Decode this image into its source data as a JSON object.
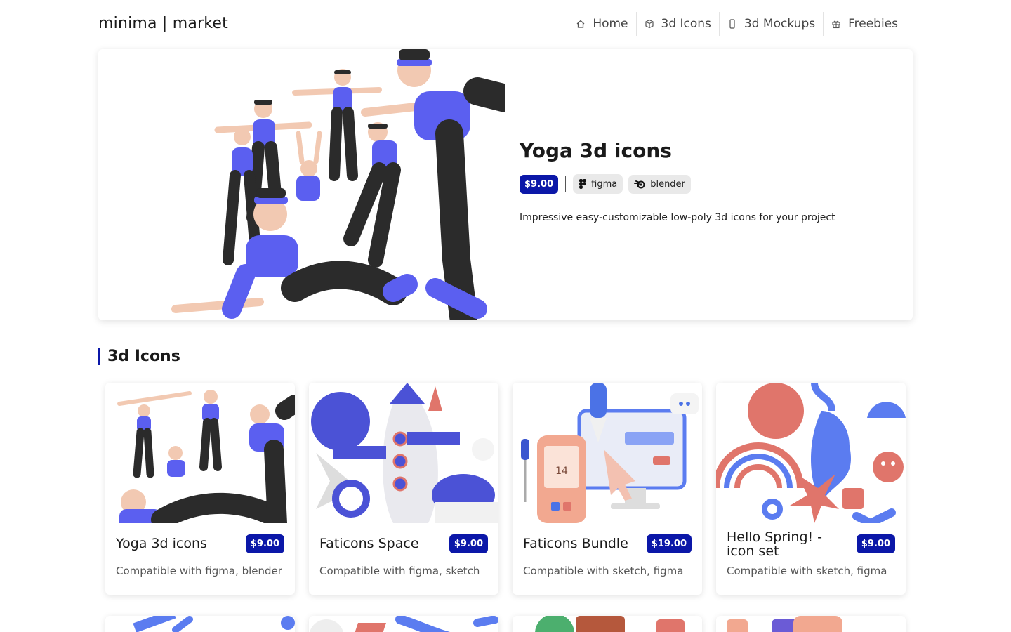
{
  "header": {
    "logo": "minima | market",
    "nav": [
      {
        "label": "Home",
        "icon": "home-icon"
      },
      {
        "label": "3d Icons",
        "icon": "cube-icon"
      },
      {
        "label": "3d Mockups",
        "icon": "phone-icon"
      },
      {
        "label": "Freebies",
        "icon": "gift-icon"
      }
    ]
  },
  "hero": {
    "title": "Yoga 3d icons",
    "price": "$9.00",
    "tools": [
      "figma",
      "blender"
    ],
    "description": "Impressive easy-customizable low-poly 3d icons for your project"
  },
  "section": {
    "title": "3d Icons"
  },
  "cards": [
    {
      "name": "Yoga 3d icons",
      "price": "$9.00",
      "compat": "Compatible with figma, blender"
    },
    {
      "name": "Faticons Space",
      "price": "$9.00",
      "compat": "Compatible with figma, sketch"
    },
    {
      "name": "Faticons Bundle",
      "price": "$19.00",
      "compat": "Compatible with sketch, figma"
    },
    {
      "name": "Hello Spring! - icon set",
      "price": "$9.00",
      "compat": "Compatible with sketch, figma"
    }
  ],
  "colors": {
    "accent": "#0b17a8",
    "figure_blue": "#5b5ff0",
    "figure_black": "#2b2b2b",
    "skin": "#f2c9b2",
    "coral": "#e0756b"
  }
}
